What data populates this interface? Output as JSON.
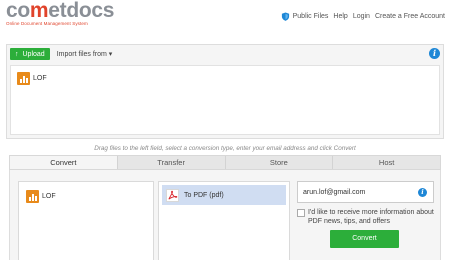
{
  "brand": {
    "name_prefix": "co",
    "name_accent": "m",
    "name_suffix": "etdocs",
    "tagline": "Online Document Management System"
  },
  "topnav": {
    "items": [
      "Public Files",
      "Help",
      "Login",
      "Create a Free Account"
    ]
  },
  "upload_bar": {
    "upload_label": "Upload",
    "import_label": "Import files from ▾"
  },
  "files": [
    {
      "name": "LOF",
      "icon": "lof-file-icon"
    }
  ],
  "hint": "Drag files to the left field, select a conversion type, enter your email address and click Convert",
  "tabs": [
    "Convert",
    "Transfer",
    "Store",
    "Host"
  ],
  "convert": {
    "selected_file": "LOF",
    "conversion": "To PDF (pdf)",
    "email_value": "arun.lof@gmail.com",
    "opt_in_text": "I'd like to receive more information about PDF news, tips, and offers",
    "convert_label": "Convert"
  },
  "colors": {
    "brand_gray": "#8a8f96",
    "brand_red": "#e0432b",
    "green": "#2cae3a",
    "info_blue": "#1e87d6",
    "file_orange": "#e88a1a",
    "selection_blue": "#d0ddf2"
  }
}
